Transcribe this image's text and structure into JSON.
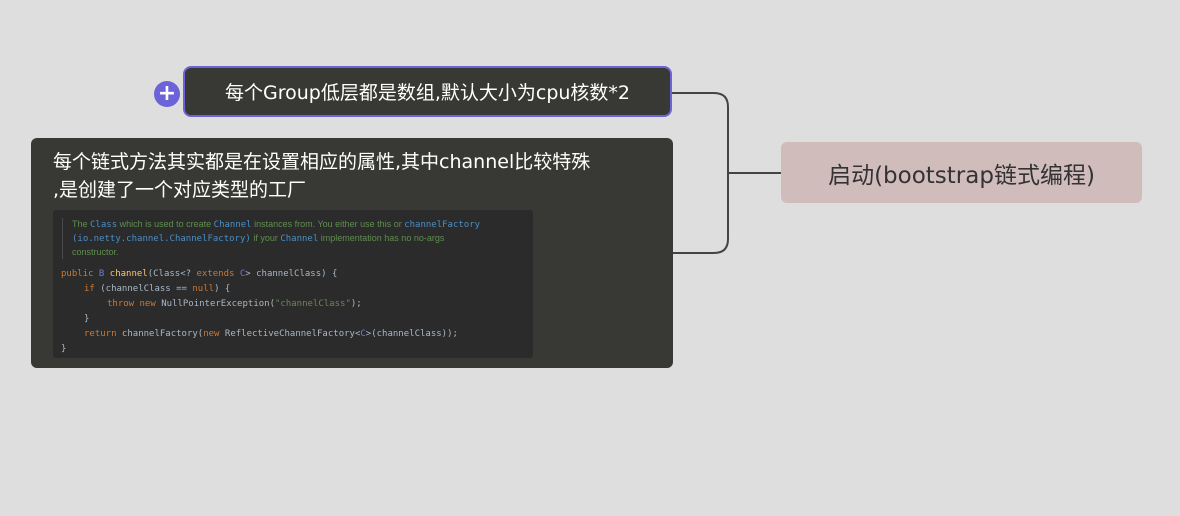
{
  "root": {
    "label": "启动(bootstrap链式编程)"
  },
  "nodes": {
    "top": {
      "label": "每个Group低层都是数组,默认大小为cpu核数*2"
    },
    "main": {
      "title_line1": "每个链式方法其实都是在设置相应的属性,其中channel比较特殊",
      "title_line2": ",是创建了一个对应类型的工厂"
    }
  },
  "code": {
    "doc": {
      "t1": "The ",
      "r1": "Class",
      "t2": " which is used to create ",
      "r2": "Channel",
      "t3": " instances from. You either use this or ",
      "r3": "channelFactory",
      "r4": "(io.netty.channel.ChannelFactory)",
      "t4": " if your ",
      "r5": "Channel",
      "t5": " implementation has no no-args",
      "t6": "constructor."
    },
    "l1": {
      "kw": "public",
      "gen1": " B ",
      "fn": "channel",
      "a": "(Class<? ",
      "kw2": "extends",
      "gen2": " C",
      "b": "> channelClass) {"
    },
    "l2": {
      "kw": "if",
      "a": " (channelClass ",
      "b": "== ",
      "kw2": "null",
      "c": ") {"
    },
    "l3": {
      "kw": "throw",
      "sp": " ",
      "kw2": "new",
      "a": " NullPointerException(",
      "str": "\"channelClass\"",
      "b": ");"
    },
    "l4": {
      "a": "}"
    },
    "l5": {
      "kw": "return",
      "a": " channelFactory(",
      "kw2": "new",
      "b": " ReflectiveChannelFactory<",
      "gen": "C",
      "c": ">(channelClass));"
    },
    "l6": {
      "a": "}"
    }
  },
  "colors": {
    "background": "#dedede",
    "node_dark": "#383834",
    "accent": "#6c63d9",
    "root_fill": "#d1bcbc"
  },
  "icons": {
    "add": "plus-icon"
  }
}
